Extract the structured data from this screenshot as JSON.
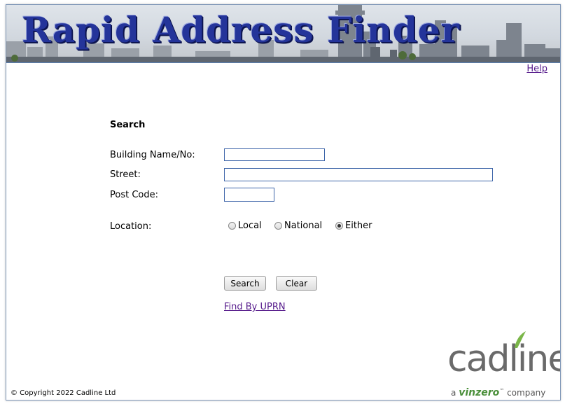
{
  "banner": {
    "title": "Rapid Address Finder"
  },
  "help_link": "Help",
  "search": {
    "heading": "Search",
    "building_label": "Building Name/No:",
    "building_value": "",
    "street_label": "Street:",
    "street_value": "",
    "postcode_label": "Post Code:",
    "postcode_value": "",
    "location_label": "Location:",
    "location_options": [
      "Local",
      "National",
      "Either"
    ],
    "location_selected": "Either",
    "search_button": "Search",
    "clear_button": "Clear",
    "uprn_link": "Find By UPRN"
  },
  "footer": {
    "copyright": "© Copyright 2022 Cadline Ltd",
    "logo": "cadline",
    "logo_prefix": "a",
    "logo_brand": "vinzero",
    "logo_tm": "™",
    "logo_suffix": "company"
  },
  "colors": {
    "banner_text": "#24349a",
    "link": "#551a8b",
    "input_border": "#3c64a8",
    "logo_accent": "#4a8f3a"
  }
}
